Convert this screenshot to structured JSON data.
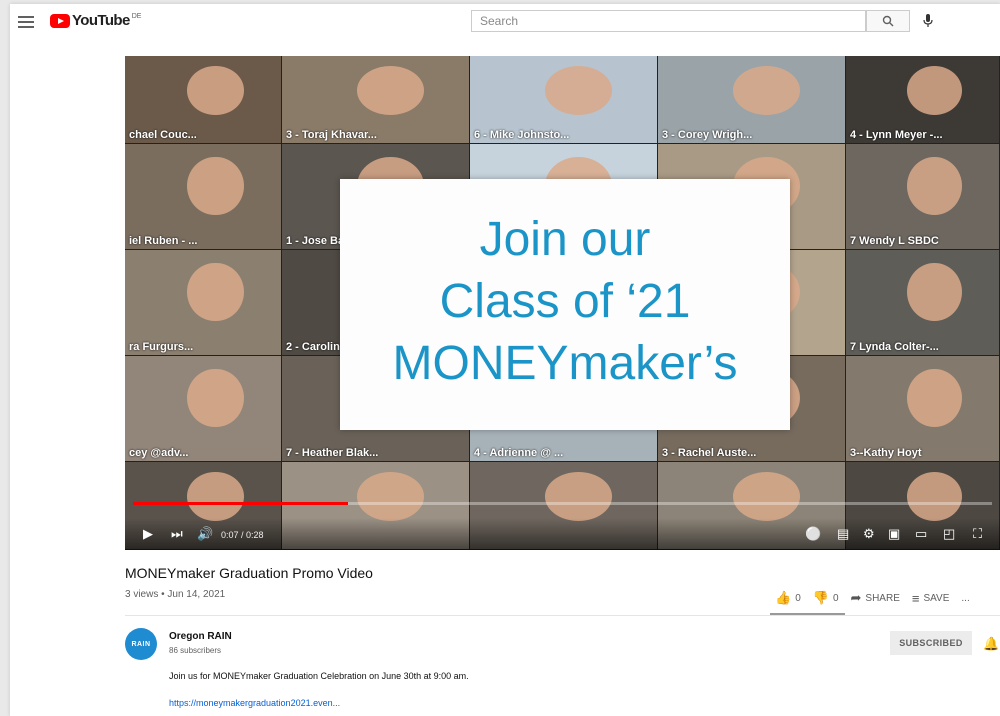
{
  "header": {
    "logo_text": "YouTube",
    "region": "DE",
    "search_placeholder": "Search"
  },
  "video": {
    "promo_lines": [
      "Join our",
      "Class of ‘21",
      "MONEYmaker’s"
    ],
    "participants": [
      {
        "name": "chael Couc..."
      },
      {
        "name": "3 - Toraj Khavar..."
      },
      {
        "name": "6 - Mike Johnsto..."
      },
      {
        "name": "3 - Corey Wrigh..."
      },
      {
        "name": "4 - Lynn Meyer -..."
      },
      {
        "name": "iel Ruben - ..."
      },
      {
        "name": "1 - Jose Ba"
      },
      {
        "name": ""
      },
      {
        "name": ""
      },
      {
        "name": "7 Wendy L SBDC"
      },
      {
        "name": "ra Furgurs..."
      },
      {
        "name": "2 - Carolin"
      },
      {
        "name": ""
      },
      {
        "name": ""
      },
      {
        "name": "7 Lynda Colter-..."
      },
      {
        "name": "cey @adv..."
      },
      {
        "name": "7 - Heather Blak..."
      },
      {
        "name": "4 - Adrienne @ ..."
      },
      {
        "name": "3 - Rachel Auste..."
      },
      {
        "name": "3--Kathy Hoyt"
      },
      {
        "name": ""
      },
      {
        "name": ""
      },
      {
        "name": ""
      },
      {
        "name": ""
      },
      {
        "name": ""
      }
    ],
    "time": "0:07 / 0:28",
    "progress_fraction": 0.25
  },
  "info": {
    "title": "MONEYmaker Graduation Promo Video",
    "meta": "3 views • Jun 14, 2021",
    "likes": "0",
    "dislikes": "0",
    "share": "SHARE",
    "save": "SAVE",
    "more": "..."
  },
  "channel": {
    "avatar_text": "RAIN",
    "name": "Oregon RAIN",
    "subscribers": "86 subscribers",
    "subscribe_label": "SUBSCRIBED"
  },
  "description": {
    "text": "Join us for MONEYmaker Graduation Celebration on June 30th at 9:00 am.",
    "link": "https://moneymakergraduation2021.even..."
  }
}
